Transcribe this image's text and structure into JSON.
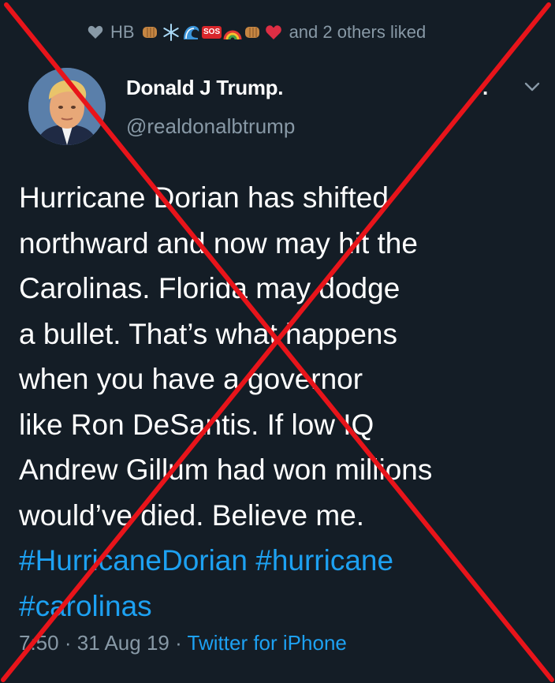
{
  "likes": {
    "liker": "HB",
    "emoji_icons": [
      "fist-emoji",
      "snowflake-emoji",
      "wave-emoji",
      "sos-emoji",
      "rainbow-emoji",
      "fist-emoji",
      "red-heart-emoji"
    ],
    "sos_text": "SOS",
    "suffix": "and 2 others liked"
  },
  "author": {
    "display_name": "Donald J Trump.",
    "handle": "@realdonalbtrump",
    "name_fragment": "."
  },
  "tweet": {
    "lines": [
      "Hurricane Dorian has shifted",
      "northward and now may hit the",
      "Carolinas. Florida may dodge",
      "a bullet. That’s what happens",
      "when you have a governor",
      "like Ron DeSantis. If low IQ",
      "Andrew Gillum had won millions",
      "would’ve died. Believe me."
    ],
    "hashtags_line1": [
      "#HurricaneDorian",
      "#hurricane"
    ],
    "hashtags_line2": [
      "#carolinas"
    ]
  },
  "meta": {
    "time": "7:50",
    "date": "31 Aug 19",
    "separator": "·",
    "source": "Twitter for iPhone"
  },
  "colors": {
    "background": "#141d26",
    "text": "#ffffff",
    "secondary": "#8899a6",
    "link": "#1da1f2",
    "cross": "#e8141a"
  }
}
